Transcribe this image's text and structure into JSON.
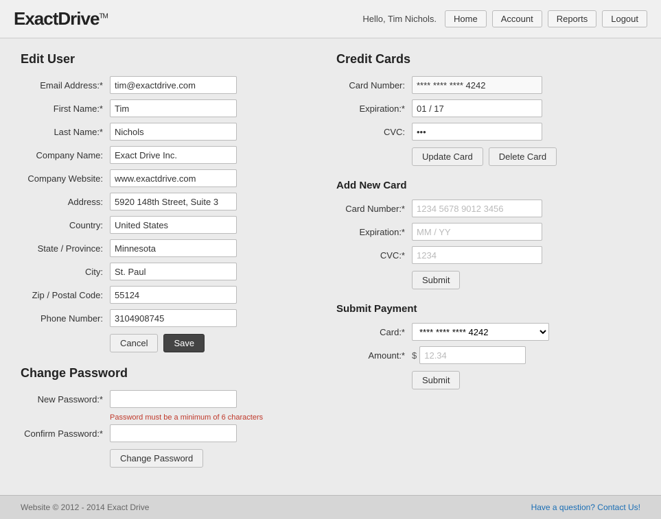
{
  "header": {
    "logo": "ExactDrive",
    "logo_tm": "TM",
    "greeting": "Hello, Tim Nichols.",
    "nav": {
      "home": "Home",
      "account": "Account",
      "reports": "Reports",
      "logout": "Logout"
    }
  },
  "edit_user": {
    "title": "Edit User",
    "fields": {
      "email_label": "Email Address:*",
      "email_value": "tim@exactdrive.com",
      "first_name_label": "First Name:*",
      "first_name_value": "Tim",
      "last_name_label": "Last Name:*",
      "last_name_value": "Nichols",
      "company_label": "Company Name:",
      "company_value": "Exact Drive Inc.",
      "website_label": "Company Website:",
      "website_value": "www.exactdrive.com",
      "address_label": "Address:",
      "address_value": "5920 148th Street, Suite 3",
      "country_label": "Country:",
      "country_value": "United States",
      "state_label": "State / Province:",
      "state_value": "Minnesota",
      "city_label": "City:",
      "city_value": "St. Paul",
      "zip_label": "Zip / Postal Code:",
      "zip_value": "55124",
      "phone_label": "Phone Number:",
      "phone_value": "3104908745"
    },
    "cancel_btn": "Cancel",
    "save_btn": "Save"
  },
  "change_password": {
    "title": "Change Password",
    "new_password_label": "New Password:*",
    "new_password_placeholder": "",
    "new_password_hint": "Password must be a minimum of 6 characters",
    "confirm_password_label": "Confirm Password:*",
    "confirm_password_placeholder": "",
    "change_btn": "Change Password"
  },
  "credit_cards": {
    "title": "Credit Cards",
    "card_number_label": "Card Number:",
    "card_number_value": "**** **** **** 4242",
    "expiration_label": "Expiration:*",
    "expiration_value": "01 / 17",
    "cvc_label": "CVC:",
    "cvc_value": "***",
    "update_btn": "Update Card",
    "delete_btn": "Delete Card"
  },
  "add_new_card": {
    "title": "Add New Card",
    "card_number_label": "Card Number:*",
    "card_number_placeholder": "1234 5678 9012 3456",
    "expiration_label": "Expiration:*",
    "expiration_placeholder": "MM / YY",
    "cvc_label": "CVC:*",
    "cvc_placeholder": "1234",
    "submit_btn": "Submit"
  },
  "submit_payment": {
    "title": "Submit Payment",
    "card_label": "Card:*",
    "card_option": "**** **** **** 4242",
    "amount_label": "Amount:*",
    "amount_prefix": "$",
    "amount_placeholder": "12.34",
    "submit_btn": "Submit"
  },
  "footer": {
    "copyright": "Website © 2012 - 2014 Exact Drive",
    "contact_link": "Have a question? Contact Us!"
  }
}
